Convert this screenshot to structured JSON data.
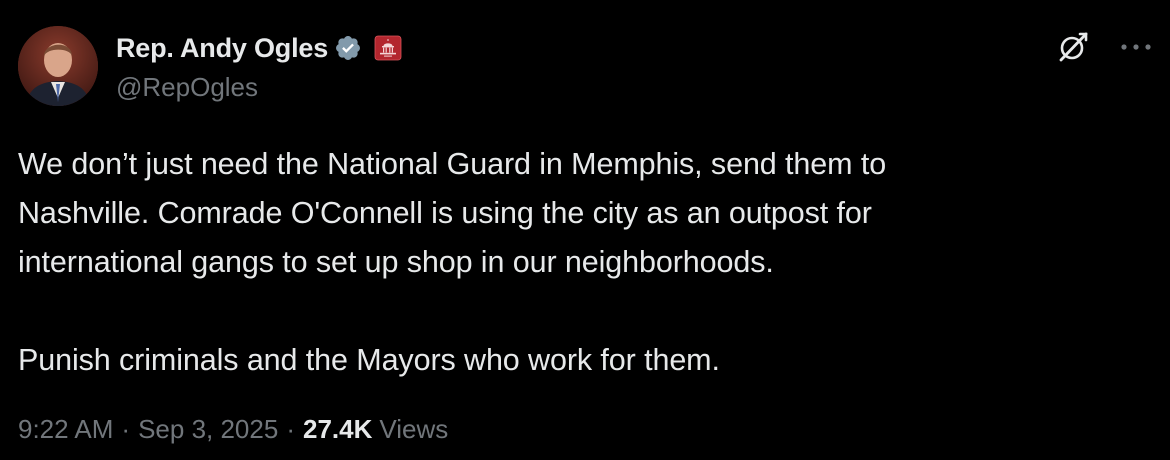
{
  "author": {
    "display_name": "Rep. Andy Ogles",
    "handle": "@RepOgles",
    "verified_badge_icon": "verified-badge-icon",
    "affiliation_badge_icon": "us-capitol-badge-icon",
    "verified_color": "#829aab",
    "affiliation_color": "#b3262e"
  },
  "actions": {
    "grok_icon": "grok-icon",
    "more_icon": "more-options-icon"
  },
  "post": {
    "paragraph_1": "We don’t just need the National Guard in Memphis, send them to\nNashville. Comrade O'Connell is using the city as an outpost for\ninternational gangs to set up shop in our neighborhoods.",
    "paragraph_2": "Punish criminals and the Mayors who work for them."
  },
  "meta": {
    "time": "9:22 AM",
    "separator": "·",
    "date": "Sep 3, 2025",
    "views_count": "27.4K",
    "views_label": "Views"
  },
  "colors": {
    "background": "#000000",
    "primary_text": "#e7e9ea",
    "secondary_text": "#71767b"
  }
}
